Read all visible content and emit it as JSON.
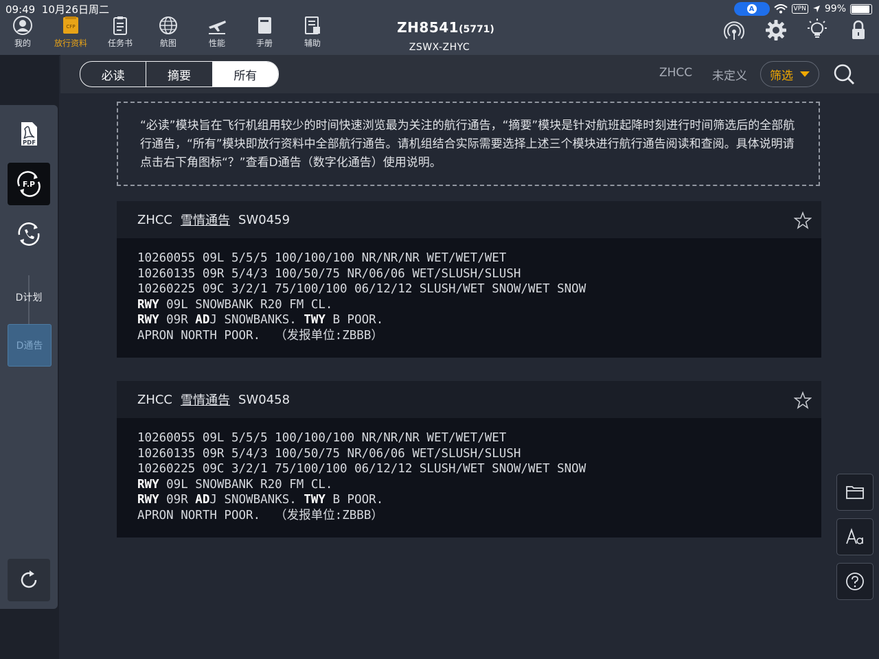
{
  "status_bar": {
    "time": "09:49",
    "date": "10月26日周二",
    "vpn": "VPN",
    "battery": "99%"
  },
  "nav": {
    "items": [
      {
        "label": "我的",
        "icon": "person-icon"
      },
      {
        "label": "放行资料",
        "icon": "cfp-folder-icon",
        "badge": "CFP"
      },
      {
        "label": "任务书",
        "icon": "clipboard-icon"
      },
      {
        "label": "航图",
        "icon": "globe-icon"
      },
      {
        "label": "性能",
        "icon": "airplane-icon"
      },
      {
        "label": "手册",
        "icon": "book-icon"
      },
      {
        "label": "辅助",
        "icon": "document-icon"
      }
    ],
    "active_index": 1,
    "accent_color": "#e8a317"
  },
  "flight": {
    "number": "ZH8541",
    "registration": "(5771)",
    "route": "ZSWX-ZHYC"
  },
  "top_tools": [
    "signal-icon",
    "gear-icon",
    "lightbulb-icon",
    "lock-icon"
  ],
  "sidebar": {
    "pdf_label": "PDF",
    "fp_label": "F.P",
    "plan_label": "D计划",
    "notice_label": "D通告"
  },
  "filter_bar": {
    "tabs": [
      "必读",
      "摘要",
      "所有"
    ],
    "selected_tab": 2,
    "airport": "ZHCC",
    "category": "未定义",
    "filter_label": "筛选",
    "filter_color": "#f2a900"
  },
  "info": {
    "text": "“必读”模块旨在飞行机组用较少的时间快速浏览最为关注的航行通告，“摘要”模块是针对航班起降时刻进行时间筛选后的全部航行通告，“所有”模块即放行资料中全部航行通告。请机组结合实际需要选择上述三个模块进行航行通告阅读和查阅。具体说明请点击右下角图标“？”查看D通告（数字化通告）使用说明。"
  },
  "notams": [
    {
      "airport": "ZHCC",
      "type": "雪情通告",
      "id": "SW0459",
      "lines": [
        "10260055 09L 5/5/5 100/100/100 NR/NR/NR WET/WET/WET",
        "10260135 09R 5/4/3 100/50/75 NR/06/06 WET/SLUSH/SLUSH",
        "10260225 09C 3/2/1 75/100/100 06/12/12 SLUSH/WET SNOW/WET SNOW"
      ],
      "rwy1_kw": "RWY",
      "rwy1_rest": " 09L SNOWBANK R20 FM CL.",
      "rwy2_kw": "RWY",
      "rwy2_mid": " 09R ",
      "rwy2_kw2": "AD",
      "rwy2_mid2": "J SNOWBANKS. ",
      "rwy2_kw3": "TWY",
      "rwy2_rest": " B POOR.",
      "apron": "APRON NORTH POOR.  （发报单位:ZBBB）"
    },
    {
      "airport": "ZHCC",
      "type": "雪情通告",
      "id": "SW0458",
      "lines": [
        "10260055 09L 5/5/5 100/100/100 NR/NR/NR WET/WET/WET",
        "10260135 09R 5/4/3 100/50/75 NR/06/06 WET/SLUSH/SLUSH",
        "10260225 09C 3/2/1 75/100/100 06/12/12 SLUSH/WET SNOW/WET SNOW"
      ],
      "rwy1_kw": "RWY",
      "rwy1_rest": " 09L SNOWBANK R20 FM CL.",
      "rwy2_kw": "RWY",
      "rwy2_mid": " 09R ",
      "rwy2_kw2": "AD",
      "rwy2_mid2": "J SNOWBANKS. ",
      "rwy2_kw3": "TWY",
      "rwy2_rest": " B POOR.",
      "apron": "APRON NORTH POOR.  （发报单位:ZBBB）"
    }
  ],
  "right_tools": [
    "folder-icon",
    "font-size-icon",
    "help-icon"
  ]
}
